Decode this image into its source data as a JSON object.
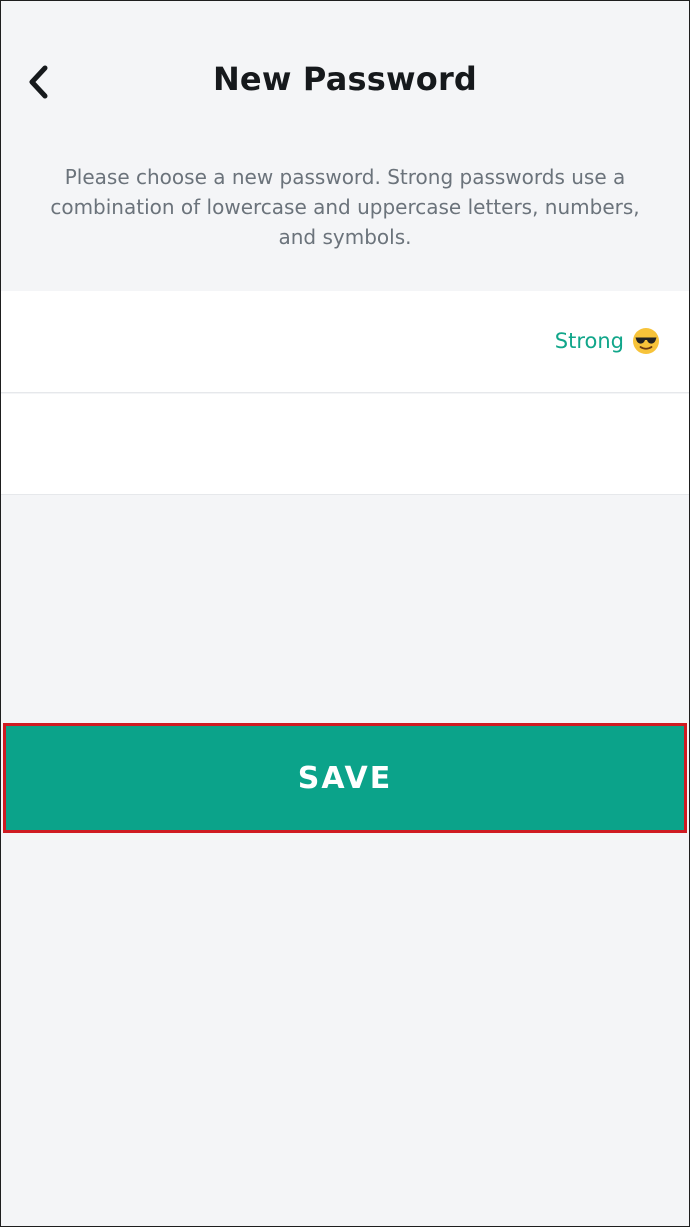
{
  "header": {
    "title": "New Password",
    "back_icon": "chevron-left-icon"
  },
  "description": "Please choose a new password. Strong passwords use a combination of lowercase and uppercase letters, numbers, and symbols.",
  "password_field": {
    "value": "",
    "strength_label": "Strong",
    "strength_icon": "sunglasses-emoji-icon"
  },
  "confirm_field": {
    "value": ""
  },
  "save_button": {
    "label": "SAVE"
  },
  "colors": {
    "accent": "#0ba38a",
    "strength_text": "#11a68a",
    "highlight_outline": "#cf1b22",
    "background": "#f4f5f7"
  }
}
